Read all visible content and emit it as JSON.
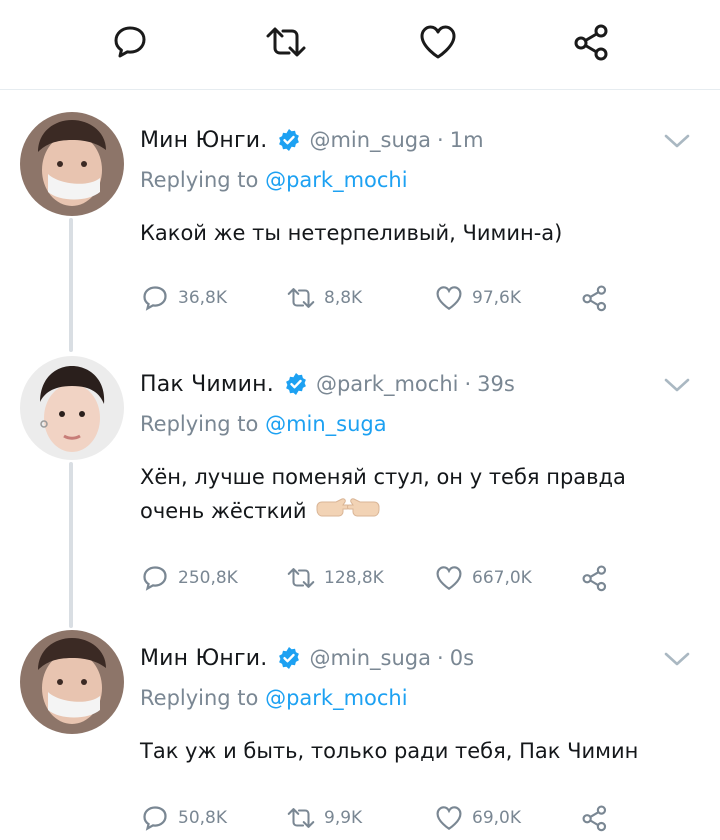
{
  "top_actions": [
    "reply-icon",
    "retweet-icon",
    "like-icon",
    "share-icon"
  ],
  "accent": "#1da1f2",
  "tweets": [
    {
      "name": "Мин Юнги.",
      "handle": "@min_suga",
      "dot": "·",
      "time": "1m",
      "replying_prefix": "Replying to ",
      "replying_to": "@park_mochi",
      "text": "Какой же ты нетерпеливый, Чимин-а)",
      "replies": "36,8K",
      "retweets": "8,8K",
      "likes": "97,6K"
    },
    {
      "name": "Пак Чимин.",
      "handle": "@park_mochi",
      "dot": "·",
      "time": "39s",
      "replying_prefix": "Replying to ",
      "replying_to": "@min_suga",
      "text": "Хён, лучше поменяй стул, он у тебя правда очень жёсткий",
      "emoji": "pointing-hands-emoji",
      "replies": "250,8K",
      "retweets": "128,8K",
      "likes": "667,0K"
    },
    {
      "name": "Мин Юнги.",
      "handle": "@min_suga",
      "dot": "·",
      "time": "0s",
      "replying_prefix": "Replying to ",
      "replying_to": "@park_mochi",
      "text": "Так уж и быть, только ради тебя, Пак Чимин",
      "replies": "50,8K",
      "retweets": "9,9K",
      "likes": "69,0K"
    }
  ]
}
